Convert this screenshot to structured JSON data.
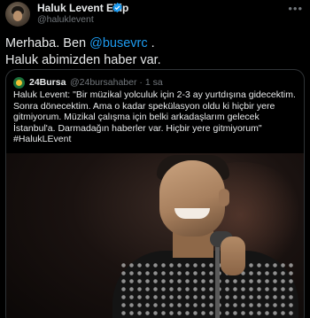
{
  "tweet": {
    "author_name": "Haluk Levent Ekip",
    "author_handle": "@haluklevent",
    "more_icon": "more-icon",
    "verified_icon": "verified-badge-icon",
    "text_prefix": "Merhaba. Ben ",
    "mention": "@busevrc",
    "text_suffix": " .",
    "text_line2": "Haluk abimizden haber var."
  },
  "quoted_tweet": {
    "author_name": "24Bursa",
    "author_handle": "@24bursahaber",
    "separator": "·",
    "time": "1 sa",
    "text": "Haluk Levent: \"Bir müzikal yolculuk için 2-3 ay yurtdışına gidecektim. Sonra dönecektim. Ama o kadar spekülasyon oldu ki hiçbir yere gitmiyorum. Müzikal çalışma için belki arkadaşlarım gelecek İstanbul'a. Darmadağın haberler var. Hiçbir yere gitmiyorum\"\n#HalukLEvent",
    "media_description_icon": "photo-singer-with-microphone"
  },
  "colors": {
    "background": "#000000",
    "text": "#e7e9ea",
    "muted": "#71767b",
    "accent": "#1d9bf0",
    "border": "#2f3336"
  }
}
